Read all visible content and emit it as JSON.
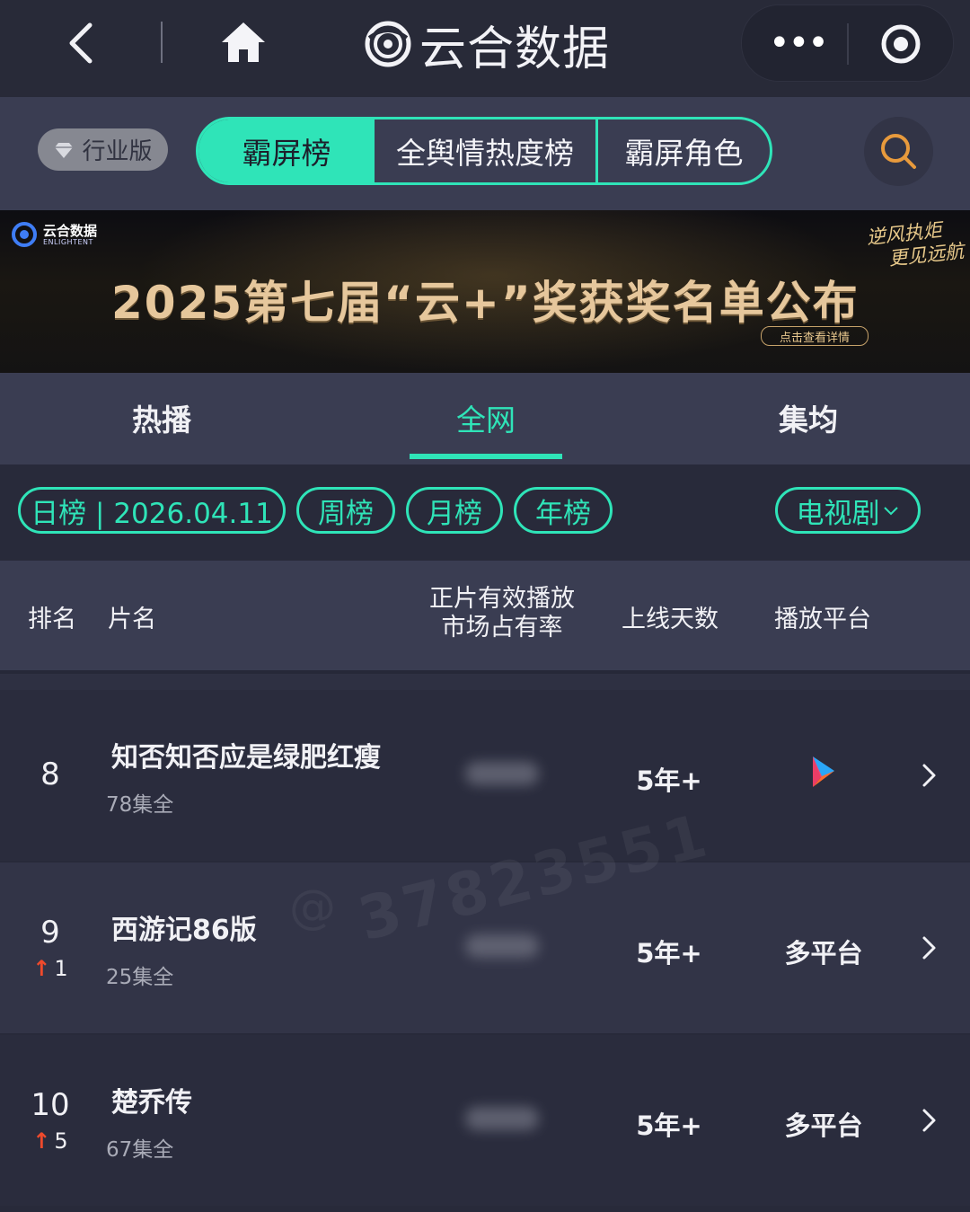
{
  "nav": {
    "title": "云合数据",
    "more_dots": "•••"
  },
  "filters": {
    "industry_label": "行业版",
    "segments": [
      "霸屏榜",
      "全舆情热度榜",
      "霸屏角色"
    ]
  },
  "banner": {
    "brand_text": "云合数据",
    "brand_sub": "ENLIGHTENT",
    "headline": "2025第七届“云+”奖获奖名单公布",
    "detail_button": "点击查看详情",
    "slogan_line1": "逆风执炬",
    "slogan_line2": "更见远航"
  },
  "tabs": [
    "热播",
    "全网",
    "集均"
  ],
  "chips": {
    "daily": "日榜 | 2026.04.11",
    "weekly": "周榜",
    "monthly": "月榜",
    "yearly": "年榜",
    "category": "电视剧"
  },
  "table": {
    "headers": {
      "rank": "排名",
      "title": "片名",
      "share_line1": "正片有效播放",
      "share_line2": "市场占有率",
      "days": "上线天数",
      "platform": "播放平台"
    },
    "rows": [
      {
        "rank": "8",
        "title": "知否知否应是绿肥红瘦",
        "episodes": "78集全",
        "days": "5年+",
        "platform": "",
        "platform_icon": "youku-icon",
        "change_arrow": "",
        "change": ""
      },
      {
        "rank": "9",
        "title": "西游记86版",
        "episodes": "25集全",
        "days": "5年+",
        "platform": "多平台",
        "platform_icon": "",
        "change_arrow": "↑",
        "change": "1"
      },
      {
        "rank": "10",
        "title": "楚乔传",
        "episodes": "67集全",
        "days": "5年+",
        "platform": "多平台",
        "platform_icon": "",
        "change_arrow": "↑",
        "change": "5"
      }
    ]
  },
  "watermark": "37823551",
  "colors": {
    "accent": "#2fe4b8",
    "up_arrow": "#ef4a2c",
    "background": "#282a3a",
    "panel": "#3a3d52"
  }
}
